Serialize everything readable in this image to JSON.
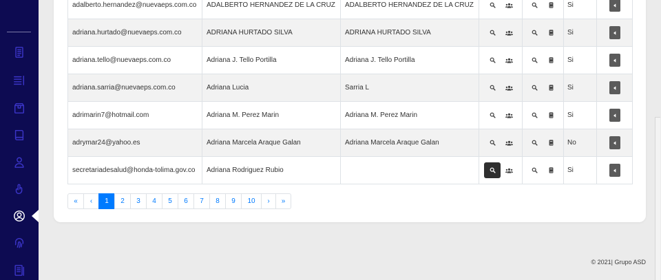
{
  "sidebar": {
    "items": [
      {
        "icon": "document-icon"
      },
      {
        "icon": "list-icon"
      },
      {
        "icon": "package-icon"
      },
      {
        "icon": "book-icon"
      },
      {
        "icon": "user-icon"
      },
      {
        "icon": "hand-pointer-icon"
      },
      {
        "icon": "user-circle-icon",
        "active": true
      },
      {
        "icon": "fingerprint-icon"
      },
      {
        "icon": "file-list-icon"
      }
    ]
  },
  "table": {
    "rows": [
      {
        "email": "adalberto.hernandez@nuevaeps.com.co",
        "name": "ADALBERTO HERNANDEZ DE LA CRUZ",
        "full_name": "ADALBERTO HERNANDEZ DE LA CRUZ",
        "enabled": "Si"
      },
      {
        "email": "adriana.hurtado@nuevaeps.com.co",
        "name": "ADRIANA HURTADO SILVA",
        "full_name": "ADRIANA HURTADO SILVA",
        "enabled": "Si"
      },
      {
        "email": "adriana.tello@nuevaeps.com.co",
        "name": "Adriana J. Tello Portilla",
        "full_name": "Adriana J. Tello Portilla",
        "enabled": "Si"
      },
      {
        "email": "adriana.sarria@nuevaeps.com.co",
        "name": "Adriana Lucia",
        "full_name": "Sarria L",
        "enabled": "Si"
      },
      {
        "email": "adrimarin7@hotmail.com",
        "name": "Adriana M. Perez Marin",
        "full_name": "Adriana M. Perez Marin",
        "enabled": "Si"
      },
      {
        "email": "adrymar24@yahoo.es",
        "name": "Adriana Marcela Araque Galan",
        "full_name": "Adriana Marcela Araque Galan",
        "enabled": "No"
      },
      {
        "email": "secretariadesalud@honda-tolima.gov.co",
        "name": "Adriana Rodriguez Rubio",
        "full_name": "",
        "enabled": "Si"
      }
    ]
  },
  "pagination": {
    "first": "«",
    "prev": "‹",
    "pages": [
      "1",
      "2",
      "3",
      "4",
      "5",
      "6",
      "7",
      "8",
      "9",
      "10"
    ],
    "active_page": "1",
    "next": "›",
    "last": "»"
  },
  "footer": {
    "text": "© 2021| Grupo ASD"
  },
  "colors": {
    "sidebar_bg": "#0d0b52",
    "sidebar_icon": "#3b35c8",
    "sidebar_icon_active": "#ffffff",
    "accent": "#007bff",
    "row_stripe": "#f2f2f2",
    "page_bg": "#ebebeb"
  }
}
